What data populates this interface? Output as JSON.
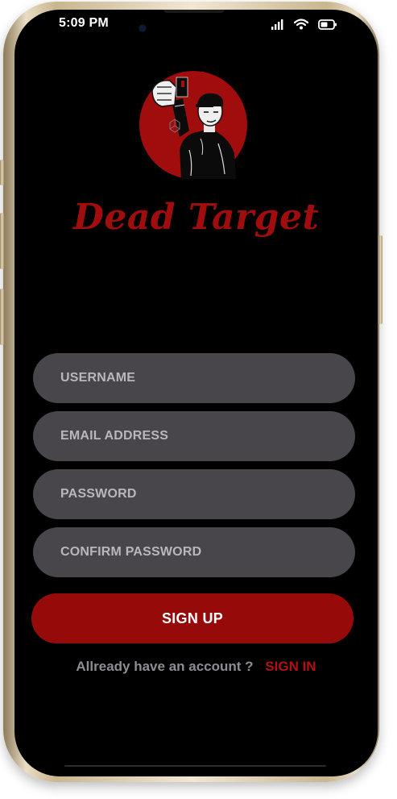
{
  "status_bar": {
    "time": "5:09 PM",
    "icons": [
      "cellular-signal-icon",
      "wifi-icon",
      "battery-icon"
    ]
  },
  "brand": {
    "logo": "shooter-logo",
    "name": "Dead Target"
  },
  "form": {
    "username_placeholder": "USERNAME",
    "email_placeholder": "EMAIL ADDRESS",
    "password_placeholder": "PASSWORD",
    "confirm_password_placeholder": "CONFIRM PASSWORD",
    "submit_label": "SIGN UP"
  },
  "footer": {
    "prompt": "Allready have an account ?",
    "signin_label": "SIGN IN"
  },
  "colors": {
    "background": "#000000",
    "accent": "#960b0a",
    "field": "#48454b",
    "field_text": "#b9b6bd",
    "muted_text": "#8e8d93"
  }
}
